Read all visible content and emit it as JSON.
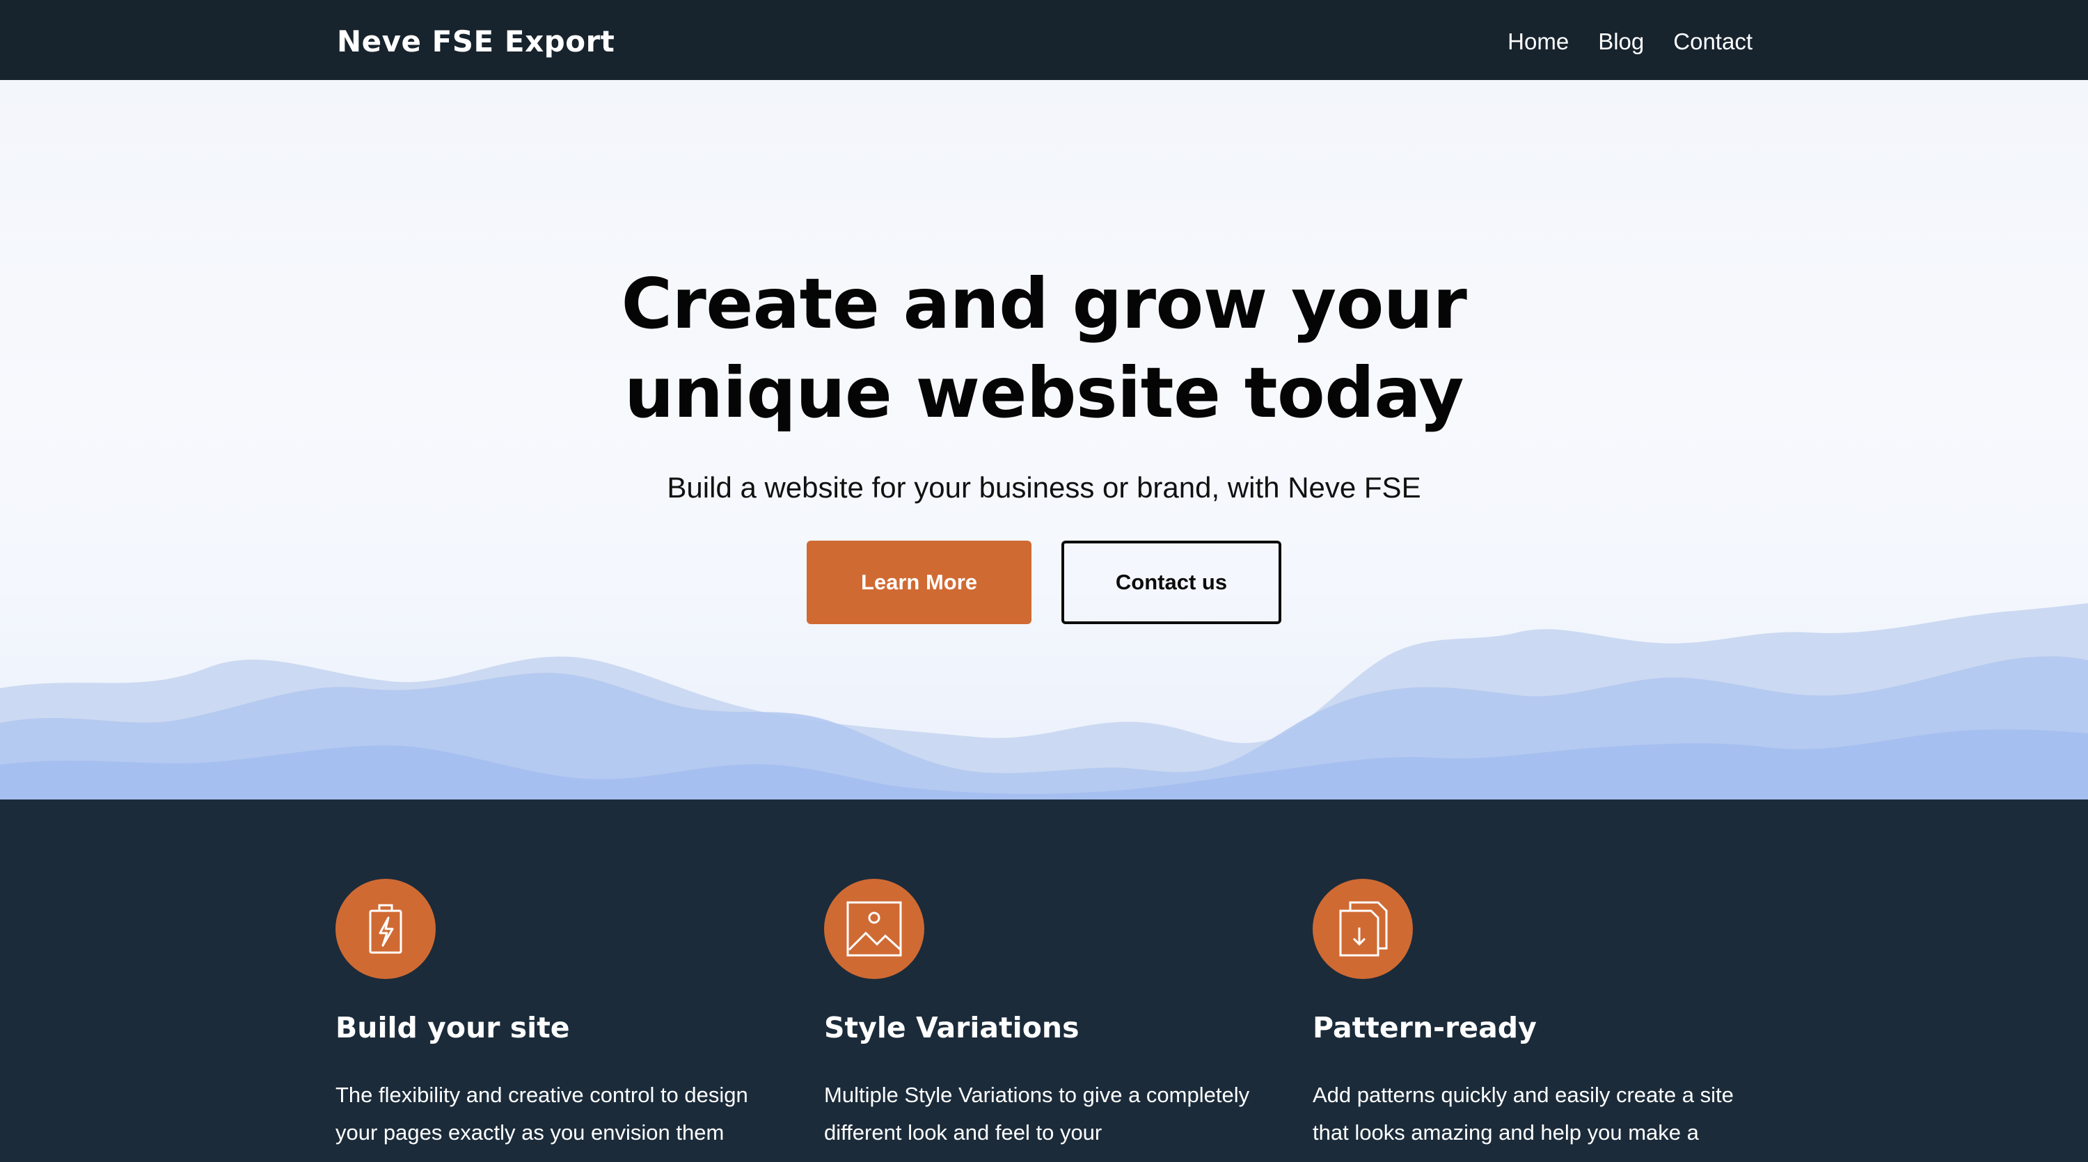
{
  "header": {
    "site_title": "Neve FSE Export",
    "nav": [
      "Home",
      "Blog",
      "Contact"
    ]
  },
  "hero": {
    "title_line1": "Create and grow your",
    "title_line2": "unique website today",
    "subtitle": "Build a website for your business or brand, with Neve FSE",
    "primary_button": "Learn More",
    "secondary_button": "Contact us"
  },
  "features": [
    {
      "icon": "battery-charge-icon",
      "title": "Build your site",
      "text": "The flexibility and creative control to design your pages exactly as you envision them"
    },
    {
      "icon": "image-icon",
      "title": "Style Variations",
      "text": "Multiple Style Variations to give a completely different look and feel to your"
    },
    {
      "icon": "documents-download-icon",
      "title": "Pattern-ready",
      "text": "Add patterns quickly and easily create a site that looks amazing and help you make a"
    }
  ],
  "colors": {
    "header_bg": "#17232d",
    "accent": "#d06a33",
    "features_bg": "#1b2b3a"
  }
}
